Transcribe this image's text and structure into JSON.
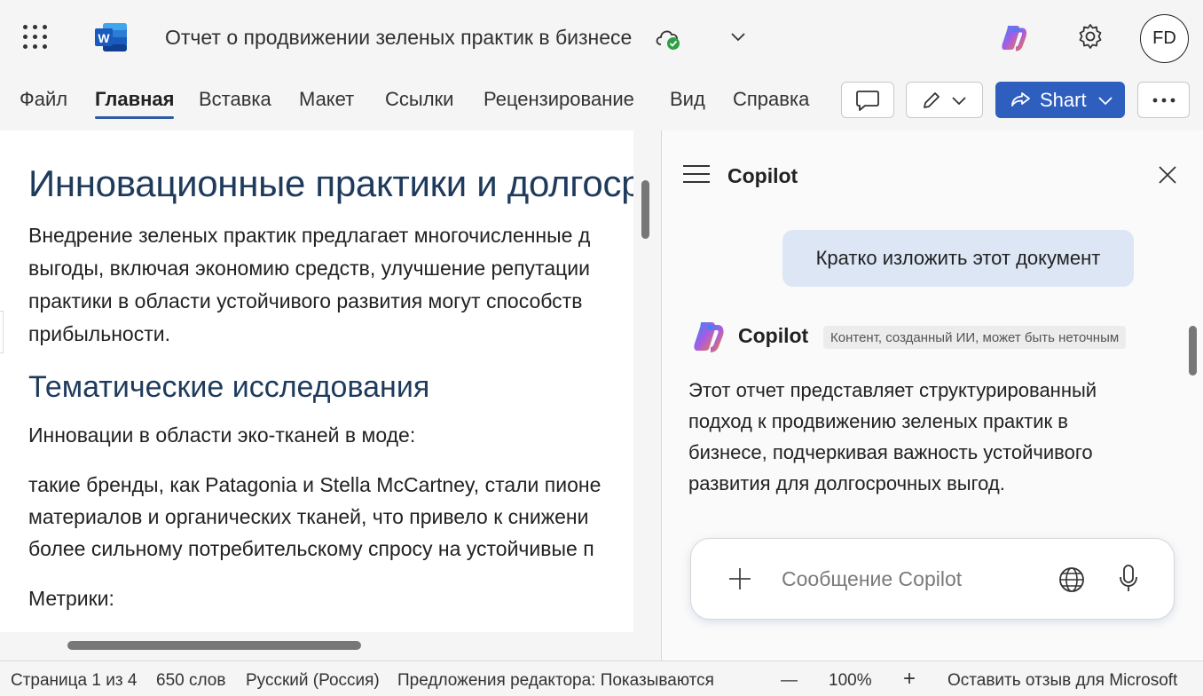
{
  "titlebar": {
    "doc_title": "Отчет о продвижении зеленых практик в бизнесе",
    "avatar_initials": "FD",
    "icons": [
      "app-launcher-icon",
      "word-logo-icon",
      "cloud-saved-icon",
      "chevron-down-icon",
      "copilot-icon",
      "gear-icon"
    ]
  },
  "ribbon": {
    "tabs": [
      "Файл",
      "Главная",
      "Вставка",
      "Макет",
      "Ссылки",
      "Рецензирование",
      "Вид",
      "Справка"
    ],
    "active_tab": "Главная",
    "share_label": "Shart"
  },
  "document": {
    "heading": "Инновационные практики и долгосрочные выгоды",
    "para1": [
      "Внедрение зеленых практик предлагает многочисленные д",
      "выгоды, включая экономию средств, улучшение репутации",
      "практики в области устойчивого развития могут способств",
      "прибыльности."
    ],
    "heading2": "Тематические исследования",
    "para2": "Инновации в области эко-тканей в моде:",
    "para3": [
      "такие бренды, как Patagonia и Stella McCartney, стали пионе",
      "материалов и органических тканей, что привело к снижени",
      "более сильному потребительскому спросу на устойчивые п"
    ],
    "para4": "Метрики:"
  },
  "copilot": {
    "title": "Copilot",
    "user_prompt": "Кратко изложить этот документ",
    "assistant_name": "Copilot",
    "ai_disclaimer": "Контент, созданный ИИ, может быть неточным",
    "response": "Этот отчет представляет структурированный подход к продвижению зеленых практик в бизнесе, подчеркивая важность устойчивого развития для долгосрочных выгод.",
    "input_placeholder": "Сообщение Copilot"
  },
  "statusbar": {
    "page": "Страница 1 из 4",
    "words": "650 слов",
    "language": "Русский (Россия)",
    "editor": "Предложения редактора: Показываются",
    "zoom_out": "—",
    "zoom": "100%",
    "zoom_in": "+",
    "feedback": "Оставить отзыв для Microsoft"
  },
  "colors": {
    "accent": "#2e5fbf",
    "heading": "#1f3b5c",
    "user_bubble": "#dce6f5"
  }
}
